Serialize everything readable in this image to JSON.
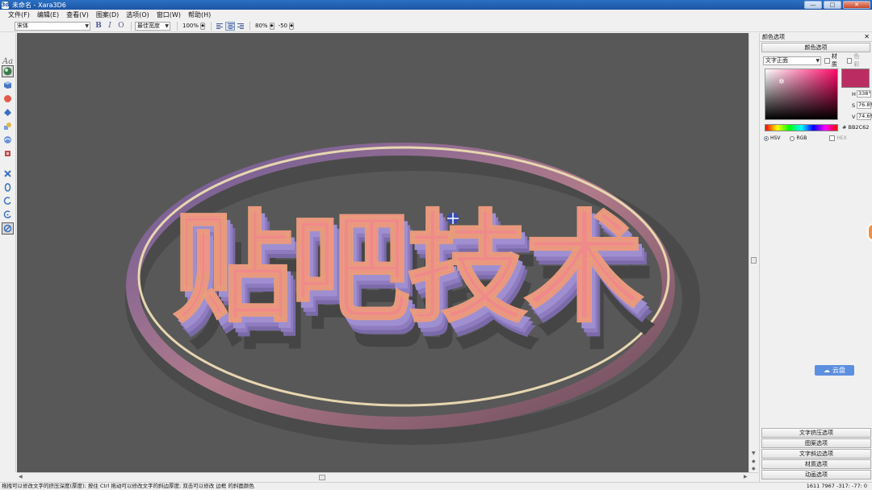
{
  "window": {
    "title": "未命名 - Xara3D6",
    "app_icon": "3d",
    "minimize": "—",
    "maximize": "□",
    "close": "✕"
  },
  "menu": [
    "文件(F)",
    "编辑(E)",
    "查看(V)",
    "图案(D)",
    "选项(O)",
    "窗口(W)",
    "帮助(H)"
  ],
  "text_toolbar": {
    "font": "宋体",
    "bold": "B",
    "italic": "I",
    "outline": "O",
    "width_mode": "最佳宽度",
    "size": "100%",
    "line_spacing": "80%",
    "letter_spacing": "-50"
  },
  "left_tools": {
    "text_label": "Aa"
  },
  "canvas": {
    "text": "贴吧技术",
    "face_color": "#f08a8a",
    "side_color": "#9a86c8",
    "ring_color": "#e7d6b0",
    "background": "#585858"
  },
  "right_panel": {
    "title": "颜色选项",
    "close": "✕",
    "section_title": "颜色选项",
    "target": "文字正面",
    "material_label": "材质",
    "color_label": "色彩",
    "swatch_color": "#BB2C62",
    "h_label": "H",
    "h_value": "338°",
    "s_label": "S",
    "s_value": "76.8%",
    "v_label": "V",
    "v_value": "74.6%",
    "hex_value": "# BB2C62",
    "mode_hsv": "HSV",
    "mode_rgb": "RGB",
    "mode_hex": "HEX",
    "cloud_label": "云盘",
    "sections": [
      "文字挤压选项",
      "图案选项",
      "文字斜边选项",
      "材质选项",
      "动画选项"
    ]
  },
  "status": {
    "hint": "拖拽可以修改文字的挤压深度(厚度); 按住 Ctrl 拖动可以修改文字的斜边厚度; 双击可以修改 边框 的斜面颜色",
    "coords": "1611 7967 -317: -77: 0"
  }
}
